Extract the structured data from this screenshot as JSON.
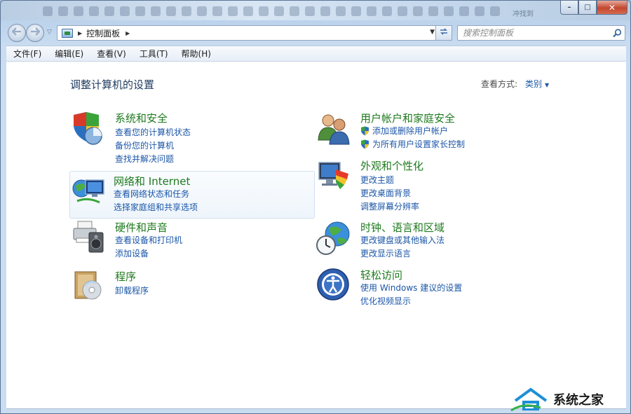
{
  "window": {
    "caption": {
      "minimize": "–",
      "maximize": "□",
      "close": "✕"
    },
    "blurred_taskbar_text": "冲找到"
  },
  "nav": {
    "back_icon": "arrow-left-icon",
    "forward_icon": "arrow-right-icon",
    "address_path": "控制面板",
    "refresh_icon": "refresh-icon",
    "search_placeholder": "搜索控制面板"
  },
  "menubar": {
    "items": [
      "文件(F)",
      "编辑(E)",
      "查看(V)",
      "工具(T)",
      "帮助(H)"
    ]
  },
  "main": {
    "title": "调整计算机的设置",
    "view_by_label": "查看方式:",
    "view_by_value": "类别",
    "categories_left": [
      {
        "title": "系统和安全",
        "icon": "shield-pie-icon",
        "links": [
          "查看您的计算机状态",
          "备份您的计算机",
          "查找并解决问题"
        ]
      },
      {
        "title": "网络和 Internet",
        "icon": "network-globe-icon",
        "links": [
          "查看网络状态和任务",
          "选择家庭组和共享选项"
        ]
      },
      {
        "title": "硬件和声音",
        "icon": "printer-speaker-icon",
        "links": [
          "查看设备和打印机",
          "添加设备"
        ]
      },
      {
        "title": "程序",
        "icon": "programs-disc-icon",
        "links": [
          "卸载程序"
        ]
      }
    ],
    "categories_right": [
      {
        "title": "用户帐户和家庭安全",
        "icon": "users-icon",
        "links": [
          "添加或删除用户帐户",
          "为所有用户设置家长控制"
        ]
      },
      {
        "title": "外观和个性化",
        "icon": "monitor-palette-icon",
        "links": [
          "更改主题",
          "更改桌面背景",
          "调整屏幕分辨率"
        ]
      },
      {
        "title": "时钟、语言和区域",
        "icon": "clock-globe-icon",
        "links": [
          "更改键盘或其他输入法",
          "更改显示语言"
        ]
      },
      {
        "title": "轻松访问",
        "icon": "ease-of-access-icon",
        "links": [
          "使用 Windows 建议的设置",
          "优化视频显示"
        ]
      }
    ]
  },
  "watermark": {
    "text": "系统之家"
  }
}
